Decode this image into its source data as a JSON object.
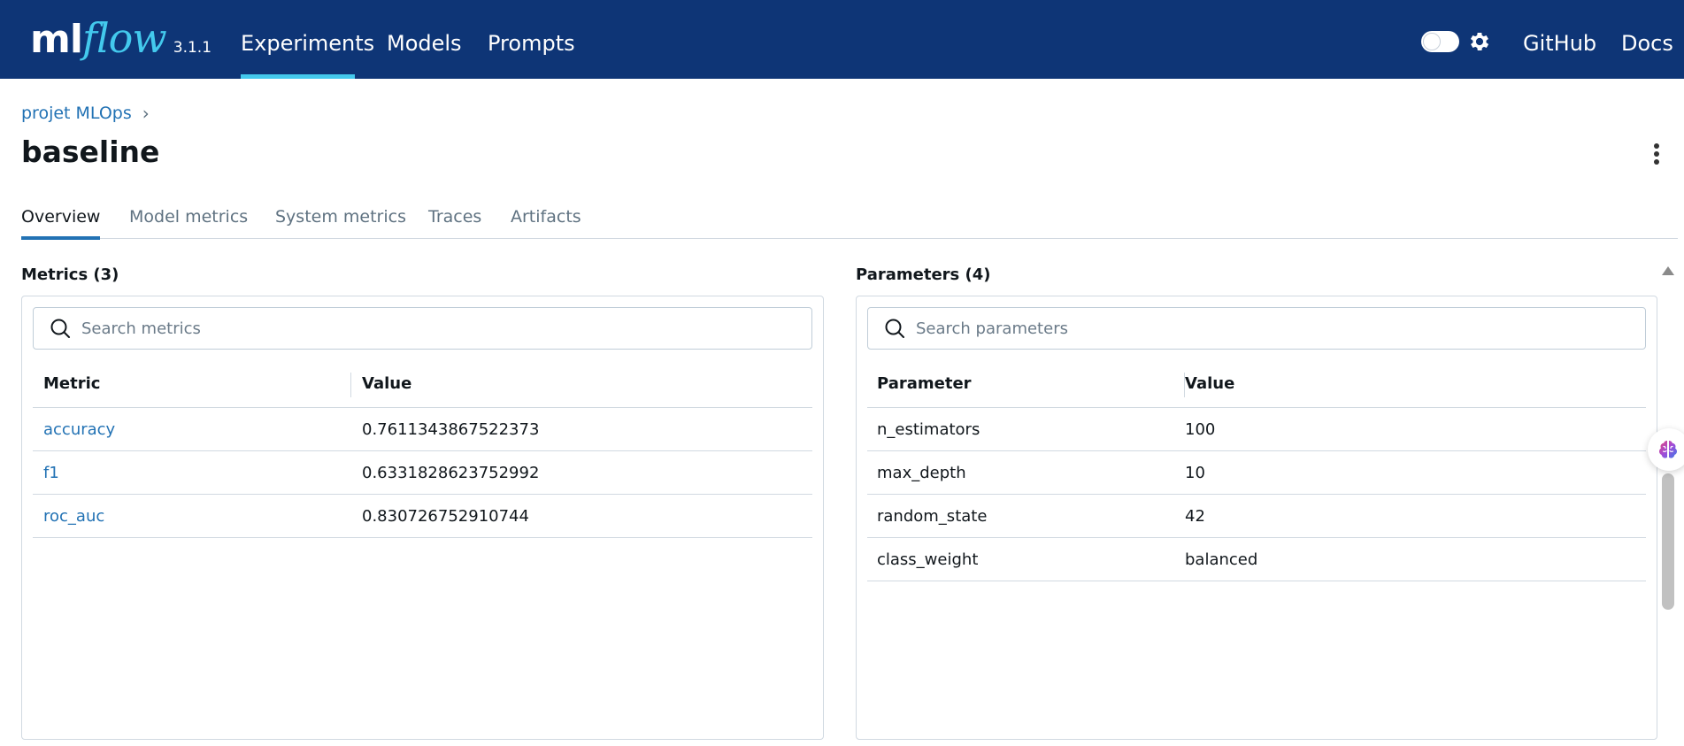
{
  "header": {
    "logo_ml": "ml",
    "logo_flow": "flow",
    "version": "3.1.1",
    "nav": [
      {
        "label": "Experiments",
        "active": true
      },
      {
        "label": "Models",
        "active": false
      },
      {
        "label": "Prompts",
        "active": false
      }
    ],
    "right_links": [
      {
        "label": "GitHub"
      },
      {
        "label": "Docs"
      }
    ],
    "colors": {
      "bar": "#0e3576",
      "accent": "#43c9ed"
    },
    "icons": [
      "theme-toggle",
      "gear-icon"
    ]
  },
  "breadcrumb": {
    "items": [
      {
        "label": "projet MLOps"
      }
    ],
    "separator": "›"
  },
  "run": {
    "name": "baseline"
  },
  "tabs": [
    {
      "label": "Overview",
      "active": true
    },
    {
      "label": "Model metrics",
      "active": false
    },
    {
      "label": "System metrics",
      "active": false
    },
    {
      "label": "Traces",
      "active": false
    },
    {
      "label": "Artifacts",
      "active": false
    }
  ],
  "metrics": {
    "title": "Metrics (3)",
    "search_placeholder": "Search metrics",
    "columns": [
      "Metric",
      "Value"
    ],
    "rows": [
      {
        "name": "accuracy",
        "value": "0.7611343867522373"
      },
      {
        "name": "f1",
        "value": "0.6331828623752992"
      },
      {
        "name": "roc_auc",
        "value": "0.830726752910744"
      }
    ]
  },
  "parameters": {
    "title": "Parameters (4)",
    "search_placeholder": "Search parameters",
    "columns": [
      "Parameter",
      "Value"
    ],
    "rows": [
      {
        "name": "n_estimators",
        "value": "100"
      },
      {
        "name": "max_depth",
        "value": "10"
      },
      {
        "name": "random_state",
        "value": "42"
      },
      {
        "name": "class_weight",
        "value": "balanced"
      }
    ]
  },
  "link_color": "#2272b4"
}
